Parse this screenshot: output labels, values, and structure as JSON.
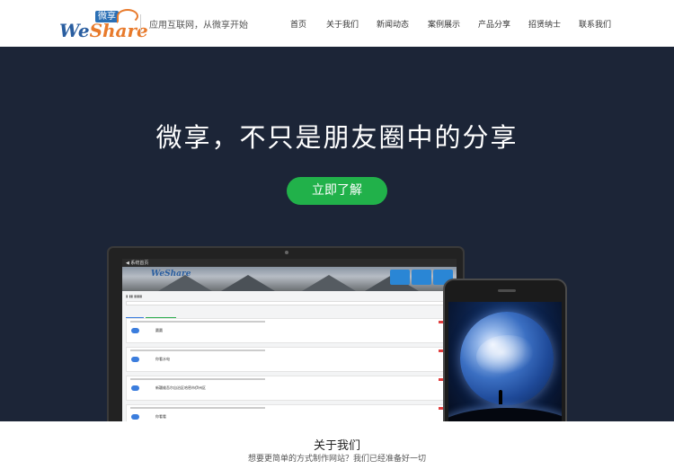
{
  "brand": {
    "logo_badge": "微享",
    "logo_word_a": "We",
    "logo_word_b": "Share",
    "slogan": "应用互联网，从微享开始"
  },
  "nav": {
    "items": [
      "首页",
      "关于我们",
      "新闻动态",
      "案例展示",
      "产品分享",
      "招贤纳士",
      "联系我们"
    ]
  },
  "hero": {
    "title": "微享，不只是朋友圈中的分享",
    "cta_label": "立即了解"
  },
  "mockup_screen": {
    "topbar_text": "◀ 系统首页",
    "logo": "WeShare",
    "rows": [
      "圆圆",
      "你看水电",
      "新疆维吾尔自治区哈密市伊州区",
      "你看看"
    ]
  },
  "about": {
    "title": "关于我们",
    "subtitle": "想要更简单的方式制作网站？我们已经准备好一切"
  },
  "colors": {
    "hero_bg": "#1c2537",
    "cta_green": "#21b14a",
    "brand_blue": "#2a5ea0",
    "brand_orange": "#e87a2b"
  }
}
